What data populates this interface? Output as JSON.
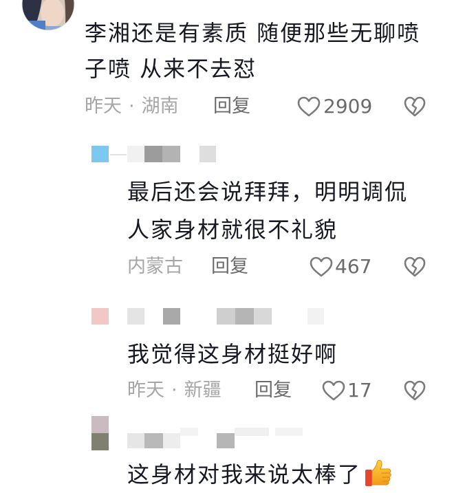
{
  "main_comment": {
    "lines": [
      "李湘还是有素质 随便那些无聊喷",
      "子喷 从来不去怼"
    ],
    "time": "昨天",
    "separator": "·",
    "location": "湖南",
    "reply_label": "回复",
    "like_count": "2909"
  },
  "replies": [
    {
      "lines": [
        "最后还会说拜拜，明明调侃",
        "人家身材就很不礼貌"
      ],
      "location": "内蒙古",
      "reply_label": "回复",
      "like_count": "467"
    },
    {
      "lines": [
        "我觉得这身材挺好啊"
      ],
      "time": "昨天",
      "separator": "·",
      "location": "新疆",
      "reply_label": "回复",
      "like_count": "17"
    },
    {
      "lines": [
        "这身材对我来说太棒了"
      ],
      "emoji": "thumbs-up-icon"
    }
  ],
  "icons": {
    "like": "heart-icon",
    "dislike": "broken-heart-icon",
    "emoji": "thumbs-up-icon"
  },
  "colors": {
    "text": "#161823",
    "meta": "#a6a6a6",
    "action": "#6b6b6b",
    "icon": "#7a7a7a",
    "background": "#ffffff"
  }
}
